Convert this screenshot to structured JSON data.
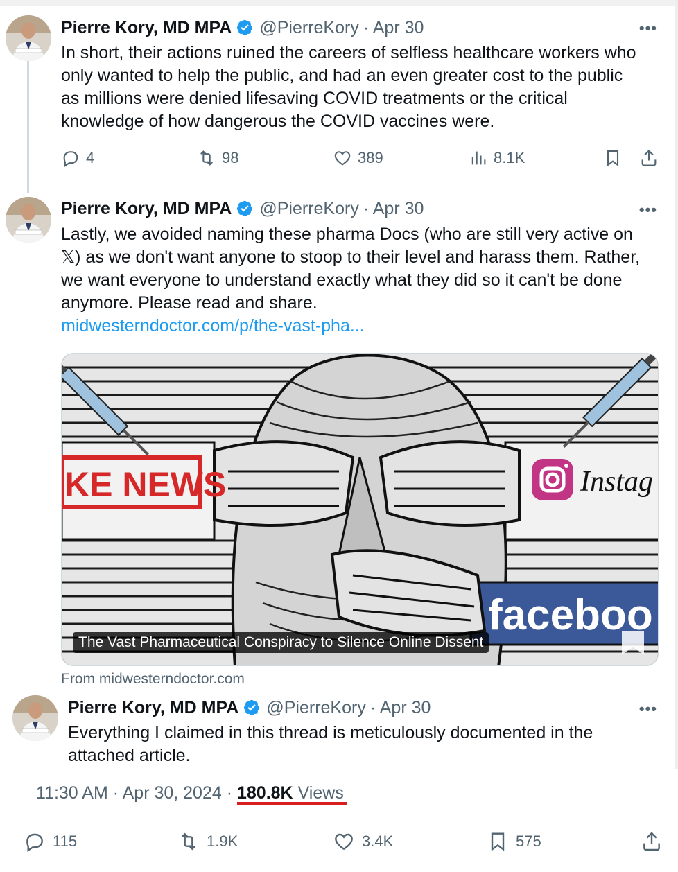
{
  "author": {
    "name": "Pierre Kory, MD MPA",
    "handle": "@PierreKory",
    "more_icon": "more-horizontal-icon"
  },
  "tweets": [
    {
      "date": "· Apr 30",
      "text_lines": [
        "In short, their actions ruined the careers of selfless healthcare workers who",
        "only wanted to help the public, and had an even greater cost to the public",
        "as millions were denied lifesaving COVID treatments or the critical",
        "knowledge of how dangerous the COVID vaccines were."
      ],
      "replies": "4",
      "reposts": "98",
      "likes": "389",
      "views": "8.1K"
    },
    {
      "date": "· Apr 30",
      "text_lines": [
        "Lastly, we avoided naming these pharma Docs (who are still very active on",
        "𝕏) as we don't want anyone to stoop to their level and harass them. Rather,",
        "we want everyone to understand exactly what they did so it can't be done",
        "anymore. Please read and share."
      ],
      "link": "midwesterndoctor.com/p/the-vast-pha...",
      "card": {
        "title": "The Vast Pharmaceutical Conspiracy to Silence Online Dissent",
        "from": "From midwesterndoctor.com",
        "fake_news_text": "KE NEWS",
        "instagram_text": "Instag",
        "facebook_text": "faceboo"
      }
    },
    {
      "date": "· Apr 30",
      "text_lines": [
        "Everything I claimed in this thread is meticulously documented in the",
        "attached article."
      ],
      "timestamp": "11:30 AM · Apr 30, 2024 ·",
      "views_count": "180.8K",
      "views_label": "Views",
      "replies": "115",
      "reposts": "1.9K",
      "likes": "3.4K",
      "bookmarks": "575"
    }
  ],
  "colors": {
    "accent": "#1d9bf0",
    "text": "#0f1419",
    "muted": "#536471",
    "underline": "#d81e1e"
  }
}
